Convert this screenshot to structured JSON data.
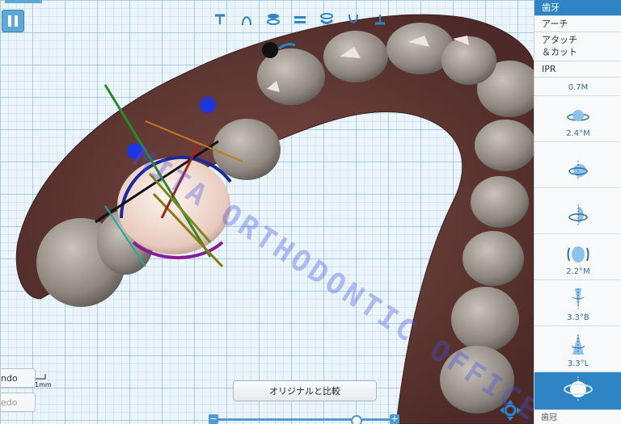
{
  "watermark": "MITA ORTHODONTIC OFFICE",
  "toolbar": {
    "icons": [
      "text-align-icon",
      "arch-icon",
      "occlusal-view-icon",
      "equal-icon",
      "upper-jaw-icon",
      "lower-jaw-icon",
      "bottom-view-icon"
    ]
  },
  "left": {
    "undo_label": "ndo",
    "redo_label": "edo",
    "scale_label": "1mm"
  },
  "compare_label": "オリジナルと比較",
  "timeline": {
    "minus": "−",
    "plus": "+",
    "position": 0.8
  },
  "panel": {
    "tabs": [
      "歯牙",
      "アーチ",
      "アタッチ",
      "＆カット",
      "IPR"
    ],
    "values": [
      "0.7M",
      "2.4°M",
      "",
      "",
      "2.2°M",
      "3.3°B",
      "3.3°L"
    ],
    "bottom_label": "歯冠"
  },
  "colors": {
    "accent": "#2f84c6",
    "gum": "#6b3f3b",
    "tooth": "#9a938c",
    "selected": "#f0dcd4"
  }
}
